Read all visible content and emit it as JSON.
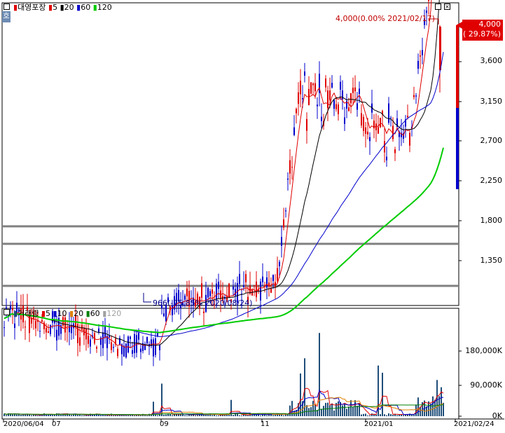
{
  "price_panel": {
    "collapse_button_label": "호",
    "stock_name": "대영포장",
    "ma_legend": [
      {
        "label": "5",
        "color": "#e00000"
      },
      {
        "label": "20",
        "color": "#000000"
      },
      {
        "label": "60",
        "color": "#0000cc"
      },
      {
        "label": "120",
        "color": "#00cc00"
      }
    ],
    "high_annotation": "4,000(0.00% 2021/02/17)",
    "low_annotation": "966(-75.85% 2020/08/24)",
    "current_price": "4,000",
    "current_change": "( 29.87%)",
    "y_ticks": [
      "3,600",
      "3,150",
      "2,700",
      "2,250",
      "1,800",
      "1,350"
    ]
  },
  "volume_panel": {
    "title": "거래량",
    "ma_legend": [
      {
        "label": "5",
        "color": "#e00000"
      },
      {
        "label": "10",
        "color": "#0000cc"
      },
      {
        "label": "20",
        "color": "#e08000"
      },
      {
        "label": "60",
        "color": "#008000"
      },
      {
        "label": "120",
        "color": "#a0a0a0"
      }
    ],
    "y_ticks": [
      "180,000K",
      "90,000K",
      "0K"
    ]
  },
  "x_axis": {
    "labels": [
      "2020/06/04",
      "07",
      "09",
      "11",
      "2021/01",
      "2021/02/24"
    ]
  },
  "colors": {
    "up": "#e00000",
    "down": "#0000cc",
    "ma5": "#e00000",
    "ma20": "#000000",
    "ma60": "#0000cc",
    "ma120": "#00cc00",
    "volume_bar": "#1f4e79",
    "support_line": "#808080"
  },
  "icons": {
    "collapse": "collapse-icon",
    "window_min": "minimize-icon",
    "window_close": "close-icon"
  }
}
